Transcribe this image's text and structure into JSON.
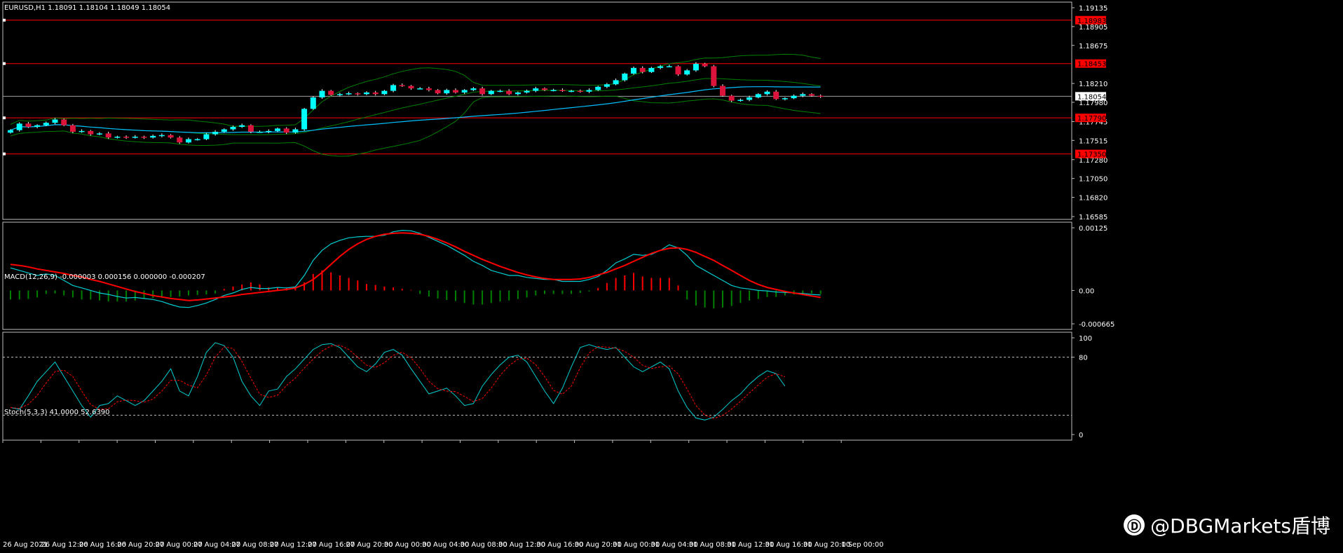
{
  "symbol_info": "EURUSD,H1  1.18091 1.18104 1.18049 1.18054",
  "macd_title": "MACD(12,26,9) -0.000003 0.000156 0.000000 -0.000207",
  "stoch_title": "Stoch(5,3,3) 41.0000 52.6390",
  "watermark": "@DBGMarkets盾博",
  "watermark_icon": "dbg-logo-icon",
  "colors": {
    "background": "#000000",
    "bull": "#00FFFF",
    "bear": "#DC143C",
    "level_line": "#FF0000",
    "bands": "#008000",
    "ma": "#00BFFF",
    "macd_line": "#00CED1",
    "signal_line": "#FF0000",
    "hist_pos": "#FF0000",
    "hist_neg": "#008000"
  },
  "chart_data": [
    {
      "type": "candlestick",
      "title": "EURUSD,H1",
      "ylim": [
        1.16585,
        1.19135
      ],
      "y_ticks": [
        "1.19135",
        "1.18905",
        "1.18675",
        "1.18210",
        "1.17980",
        "1.17745",
        "1.17515",
        "1.17280",
        "1.17050",
        "1.16820",
        "1.16585"
      ],
      "x_ticks": [
        "26 Aug 2021",
        "26 Aug 12:00",
        "26 Aug 16:00",
        "26 Aug 20:00",
        "27 Aug 00:00",
        "27 Aug 04:00",
        "27 Aug 08:00",
        "27 Aug 12:00",
        "27 Aug 16:00",
        "27 Aug 20:00",
        "30 Aug 00:00",
        "30 Aug 04:00",
        "30 Aug 08:00",
        "30 Aug 12:00",
        "30 Aug 16:00",
        "30 Aug 20:00",
        "31 Aug 00:00",
        "31 Aug 04:00",
        "31 Aug 08:00",
        "31 Aug 12:00",
        "31 Aug 16:00",
        "31 Aug 20:00",
        "1 Sep 00:00"
      ],
      "levels": [
        "1.18983",
        "1.18453",
        "1.17790",
        "1.17350"
      ],
      "current_price": "1.18054",
      "closes": [
        1.1764,
        1.1772,
        1.1768,
        1.177,
        1.1773,
        1.1777,
        1.177,
        1.1762,
        1.1763,
        1.1759,
        1.176,
        1.1755,
        1.1756,
        1.1755,
        1.1756,
        1.1755,
        1.1757,
        1.1758,
        1.1755,
        1.1749,
        1.1753,
        1.1753,
        1.1759,
        1.1762,
        1.1765,
        1.1768,
        1.177,
        1.1762,
        1.1762,
        1.1763,
        1.1766,
        1.1761,
        1.1765,
        1.179,
        1.1804,
        1.1812,
        1.1807,
        1.1808,
        1.1809,
        1.1808,
        1.181,
        1.1808,
        1.1812,
        1.1819,
        1.1818,
        1.1815,
        1.1815,
        1.1813,
        1.1809,
        1.1813,
        1.181,
        1.1813,
        1.1815,
        1.1808,
        1.1812,
        1.1812,
        1.1808,
        1.181,
        1.1812,
        1.1815,
        1.1813,
        1.1813,
        1.1812,
        1.1812,
        1.1811,
        1.1813,
        1.1817,
        1.182,
        1.1825,
        1.1833,
        1.184,
        1.1835,
        1.184,
        1.1842,
        1.1842,
        1.1832,
        1.1837,
        1.1845,
        1.1842,
        1.1818,
        1.1806,
        1.18,
        1.1801,
        1.1804,
        1.1808,
        1.1811,
        1.1802,
        1.1803,
        1.1806,
        1.1808,
        1.1806,
        1.1805
      ],
      "series": [
        {
          "name": "",
          "kind": "bollinger_upper"
        },
        {
          "name": "",
          "kind": "bollinger_lower"
        },
        {
          "name": "",
          "kind": "moving_average"
        }
      ]
    },
    {
      "type": "macd",
      "title": "MACD(12,26,9)",
      "ylim": [
        -0.000665,
        0.00125
      ],
      "y_ticks": [
        "0.00125",
        "0.00",
        "-0.000665"
      ],
      "macd": [
        0.00045,
        0.0004,
        0.00035,
        0.0003,
        0.00033,
        0.0003,
        0.0002,
        0.0001,
        5e-05,
        0.0,
        -5e-05,
        -8e-05,
        -0.00012,
        -0.00015,
        -0.00014,
        -0.00016,
        -0.00018,
        -0.00022,
        -0.00028,
        -0.00033,
        -0.00034,
        -0.0003,
        -0.00025,
        -0.00018,
        -0.0001,
        -5e-05,
        2e-05,
        6e-05,
        4e-05,
        4e-05,
        6e-05,
        5e-05,
        7e-05,
        0.0003,
        0.0006,
        0.0008,
        0.00093,
        0.001,
        0.00105,
        0.00107,
        0.00108,
        0.00108,
        0.0011,
        0.00117,
        0.0012,
        0.00119,
        0.00114,
        0.00106,
        0.00098,
        0.0009,
        0.0008,
        0.0007,
        0.00058,
        0.0005,
        0.0004,
        0.00035,
        0.0003,
        0.0003,
        0.00026,
        0.00024,
        0.00022,
        0.00022,
        0.00018,
        0.00018,
        0.00018,
        0.00022,
        0.00028,
        0.0004,
        0.00055,
        0.00063,
        0.00072,
        0.0007,
        0.00072,
        0.0008,
        0.00091,
        0.00085,
        0.0007,
        0.0005,
        0.0004,
        0.0003,
        0.0002,
        0.0001,
        5e-05,
        3e-05,
        0.0,
        -1e-05,
        -3e-05,
        -4e-05,
        -5e-05,
        -6e-05,
        -8e-05,
        -9e-05
      ],
      "signal": [
        0.00052,
        0.0005,
        0.00047,
        0.00043,
        0.0004,
        0.00037,
        0.00034,
        0.0003,
        0.00027,
        0.00022,
        0.00018,
        0.00013,
        8e-05,
        3e-05,
        -2e-05,
        -6e-05,
        -0.0001,
        -0.00013,
        -0.00016,
        -0.00018,
        -0.0002,
        -0.00019,
        -0.00017,
        -0.00015,
        -0.00013,
        -0.00011,
        -8e-05,
        -6e-05,
        -4e-05,
        -2e-05,
        0.0,
        2e-05,
        5e-05,
        0.00012,
        0.00022,
        0.00036,
        0.00052,
        0.00068,
        0.00082,
        0.00093,
        0.00102,
        0.00108,
        0.00112,
        0.00114,
        0.00115,
        0.00114,
        0.00112,
        0.00108,
        0.00102,
        0.00095,
        0.00087,
        0.00078,
        0.0007,
        0.00062,
        0.00055,
        0.00048,
        0.00042,
        0.00036,
        0.00031,
        0.00027,
        0.00024,
        0.00022,
        0.00022,
        0.00022,
        0.00023,
        0.00026,
        0.00031,
        0.00036,
        0.00043,
        0.0005,
        0.00058,
        0.00066,
        0.00074,
        0.0008,
        0.00084,
        0.00085,
        0.00082,
        0.00076,
        0.00068,
        0.0006,
        0.0005,
        0.0004,
        0.0003,
        0.0002,
        0.00012,
        6e-05,
        2e-05,
        -2e-05,
        -5e-05,
        -8e-05,
        -0.00011,
        -0.00014
      ],
      "histogram": [
        -0.00018,
        -0.00018,
        -0.00017,
        -0.00014,
        -7e-05,
        -6e-05,
        -0.0001,
        -0.00014,
        -0.00018,
        -0.00018,
        -0.0002,
        -0.00022,
        -0.00022,
        -0.00022,
        -0.0002,
        -0.00017,
        -0.00015,
        -0.00013,
        -0.00013,
        -0.00012,
        -0.0001,
        -9e-05,
        -8e-05,
        -6e-05,
        3e-05,
        8e-05,
        0.00012,
        0.00016,
        0.00012,
        6e-05,
        6e-05,
        5e-05,
        4e-05,
        0.00016,
        0.00033,
        0.0004,
        0.00036,
        0.0003,
        0.00025,
        0.0002,
        0.00013,
        0.00011,
        8e-05,
        6e-05,
        3e-05,
        1e-05,
        -7e-05,
        -0.00012,
        -0.00016,
        -0.00019,
        -0.00021,
        -0.00025,
        -0.00028,
        -0.00028,
        -0.00025,
        -0.00022,
        -0.0002,
        -0.00017,
        -0.00014,
        -0.0001,
        -7e-05,
        -7e-05,
        -7e-05,
        -7e-05,
        -5e-05,
        -2e-05,
        5e-05,
        0.00015,
        0.00025,
        0.0003,
        0.00035,
        0.00028,
        0.00025,
        0.00025,
        0.00025,
        0.0001,
        -0.00018,
        -0.0003,
        -0.00034,
        -0.00036,
        -0.00034,
        -0.00031,
        -0.00025,
        -0.0002,
        -0.00017,
        -0.00013,
        -0.00013,
        -0.0001,
        -8e-05,
        -7e-05,
        -6e-05,
        -7e-05
      ]
    },
    {
      "type": "line",
      "title": "Stoch(5,3,3)",
      "ylim": [
        0,
        100
      ],
      "y_ticks": [
        "100",
        "80",
        "0"
      ],
      "levels": [
        80,
        20
      ],
      "main": [
        28,
        26,
        40,
        55,
        65,
        75,
        60,
        45,
        30,
        18,
        30,
        32,
        40,
        35,
        30,
        35,
        45,
        55,
        68,
        45,
        40,
        60,
        85,
        95,
        92,
        80,
        55,
        40,
        30,
        45,
        47,
        60,
        68,
        78,
        88,
        93,
        94,
        90,
        80,
        70,
        65,
        73,
        85,
        88,
        82,
        68,
        55,
        42,
        45,
        48,
        40,
        30,
        32,
        50,
        62,
        72,
        80,
        82,
        75,
        60,
        45,
        32,
        48,
        70,
        90,
        93,
        90,
        88,
        90,
        80,
        70,
        65,
        70,
        75,
        68,
        45,
        28,
        17,
        15,
        18,
        26,
        35,
        42,
        52,
        60,
        66,
        63,
        50
      ]
    }
  ]
}
